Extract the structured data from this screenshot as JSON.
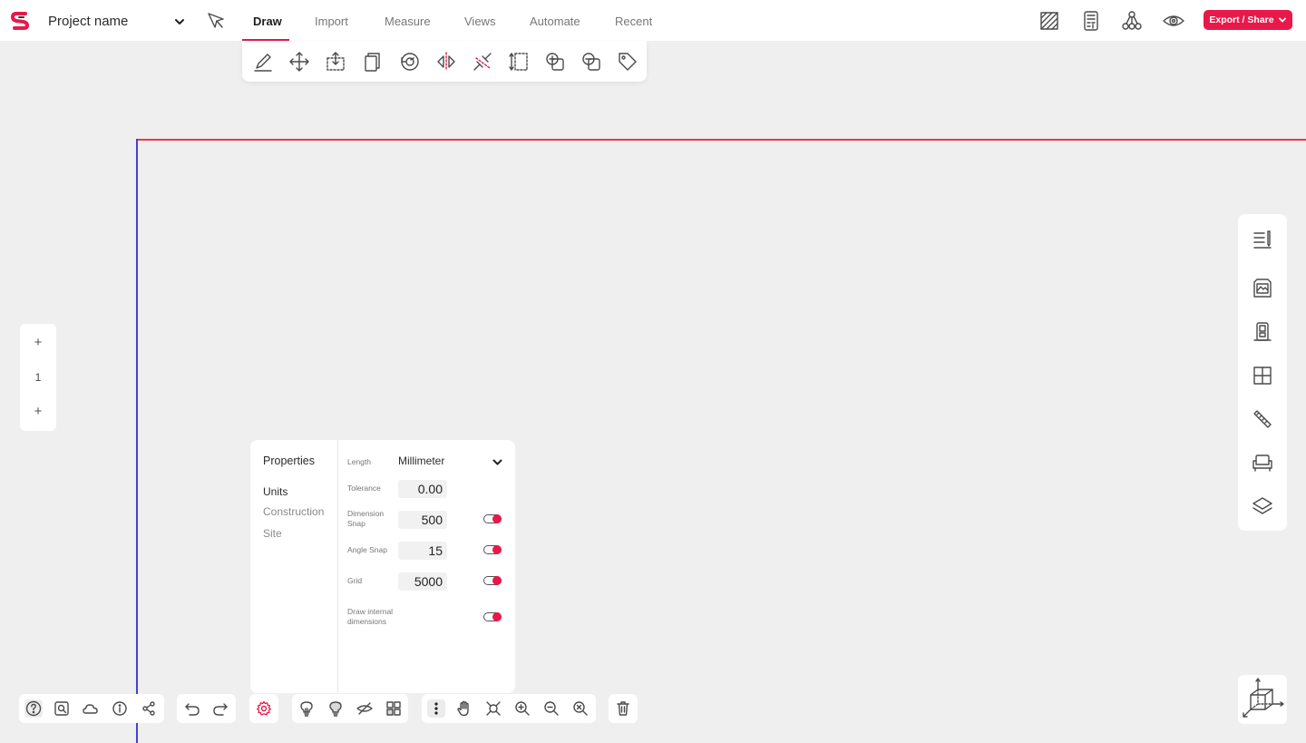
{
  "app": {
    "project_name": "Project name"
  },
  "tabs": [
    {
      "label": "Draw",
      "active": true
    },
    {
      "label": "Import"
    },
    {
      "label": "Measure"
    },
    {
      "label": "Views"
    },
    {
      "label": "Automate"
    },
    {
      "label": "Recent"
    }
  ],
  "export_label": "Export / Share",
  "accent_color": "#e8194a",
  "level": {
    "current": "1",
    "add_above": "+",
    "add_below": "+"
  },
  "properties": {
    "title": "Properties",
    "nav": [
      "Units",
      "Construction",
      "Site"
    ],
    "active_nav": "Units",
    "length_label": "Length",
    "length_unit": "Millimeter",
    "tolerance_label": "Tolerance",
    "tolerance_value": "0.00",
    "dimension_snap_label": "Dimension Snap",
    "dimension_snap_value": "500",
    "angle_snap_label": "Angle Snap",
    "angle_snap_value": "15",
    "grid_label": "Grid",
    "grid_value": "5000",
    "internal_dims_label": "Draw internal dimensions"
  },
  "icons": {
    "draw_tools": [
      "pencil-icon",
      "move-icon",
      "move-selection-icon",
      "copy-icon",
      "rotate-icon",
      "mirror-icon",
      "split-icon",
      "extend-icon",
      "add-shape-icon",
      "subtract-shape-icon",
      "tag-icon"
    ],
    "top_right": [
      "hatch-icon",
      "calculator-icon",
      "network-icon",
      "eye-icon"
    ],
    "right_panel": [
      "notes-icon",
      "picture-icon",
      "door-icon",
      "window-icon",
      "measuring-tape-icon",
      "sofa-icon",
      "layers-icon"
    ],
    "bottom": [
      "help-icon",
      "search-icon",
      "cloud-icon",
      "info-icon",
      "share-icon",
      "undo-icon",
      "redo-icon",
      "settings-icon",
      "bulb-off-icon",
      "bulb-on-icon",
      "hide-icon",
      "component-icon",
      "more-icon",
      "hand-icon",
      "zoom-fit-icon",
      "zoom-in-icon",
      "zoom-out-icon",
      "zoom-reset-icon",
      "trash-icon"
    ]
  }
}
